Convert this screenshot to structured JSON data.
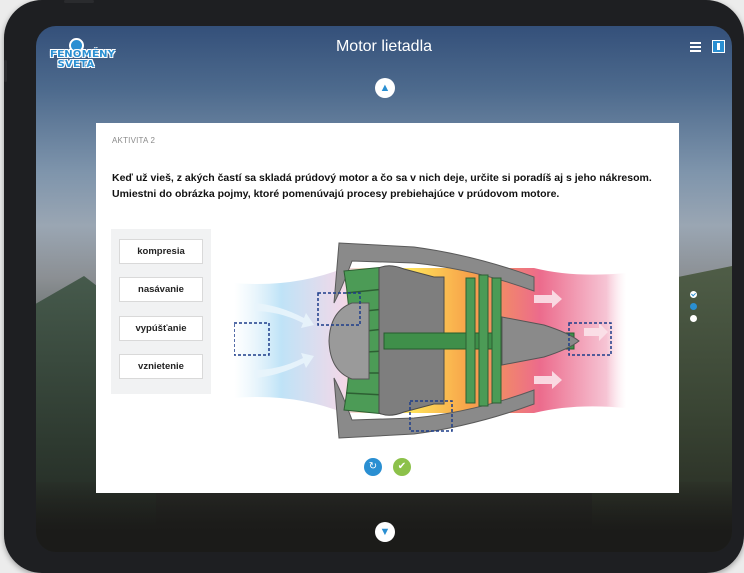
{
  "header": {
    "title": "Motor lietadla",
    "logo_text_top": "FENOMÉNY",
    "logo_text_bottom": "SVETA"
  },
  "activity": {
    "label": "AKTIVITA 2",
    "instructions": "Keď už vieš, z akých častí sa skladá prúdový motor a čo sa v nich deje, určite si poradíš aj s jeho nákresom. Umiestni do obrázka pojmy, ktoré pomenúvajú procesy prebiehajúce v prúdovom motore."
  },
  "terms": [
    "kompresia",
    "nasávanie",
    "vypúšťanie",
    "vznietenie"
  ],
  "controls": {
    "nav_up_icon": "chevron-up-icon",
    "nav_down_icon": "chevron-down-icon",
    "reset_icon": "refresh-icon",
    "check_icon": "check-icon",
    "menu_icon": "hamburger-icon",
    "book_icon": "book-icon"
  },
  "colors": {
    "accent": "#2a8fd2",
    "check": "#8cc14a",
    "intake": "#bfe3f7",
    "compression": "#f2d8e8",
    "combustion": "#ffe35a",
    "exhaust": "#ec6b8c",
    "metal": "#7e7e7e",
    "blades": "#3f8f4a"
  }
}
